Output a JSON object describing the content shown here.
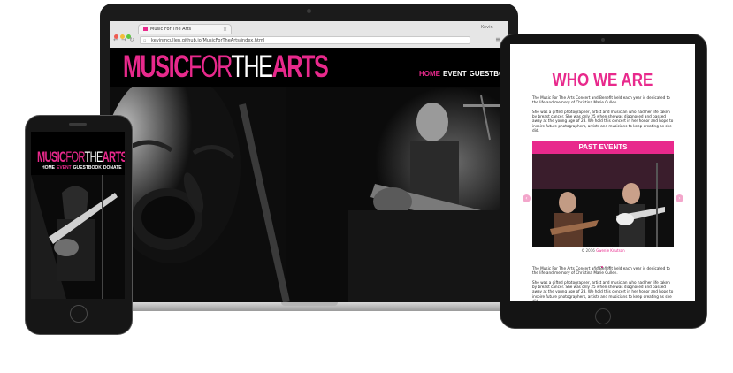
{
  "colors": {
    "brand_pink": "#e8298c",
    "black": "#000000",
    "white": "#ffffff"
  },
  "logo": {
    "part1": "MUSIC",
    "part2": "FOR",
    "part3": "THE",
    "part4": "ARTS"
  },
  "laptop": {
    "browser": {
      "tab_title": "Music For The Arts",
      "tab_close": "×",
      "url": "kevinmcullen.github.io/MusicForTheArts/index.html",
      "user": "Kevin",
      "back_icon": "←",
      "forward_icon": "→",
      "reload_icon": "↻",
      "menu_icon": "≡"
    },
    "nav": [
      "HOME",
      "EVENT",
      "GUESTBOOK"
    ],
    "scroll_icon": "⌄"
  },
  "phone": {
    "nav": [
      "HOME",
      "EVENT",
      "GUESTBOOK",
      "DONATE"
    ]
  },
  "tablet": {
    "title": "WHO WE ARE",
    "para1": "The Music For The Arts Concert and Benefit held each year is dedicated to the life and memory of Christina Marie Cullen.",
    "para2": "She was a gifted photographer, artist and musician who had her life taken by breast cancer. She was only 25 when she was diagnosed and passed away at the young age of 28. We hold this concert in her honor and hope to inspire future photographers, artists and musicians to keep creating as she did.",
    "past_events": "PAST EVENTS",
    "credit_prefix": "© 2016",
    "credit_name": "Gwenie Knutson",
    "prev_icon": "‹",
    "next_icon": "›",
    "para3": "The Music For The Arts Concert and Benefit held each year is dedicated to the life and memory of Christina Marie Cullen.",
    "para4": "She was a gifted photographer, artist and musician who had her life taken by breast cancer. She was only 25 when she was diagnosed and passed away at the young age of 28. We hold this concert in her honor and hope to inspire future photographers, artists and musicians to keep creating as she did."
  }
}
